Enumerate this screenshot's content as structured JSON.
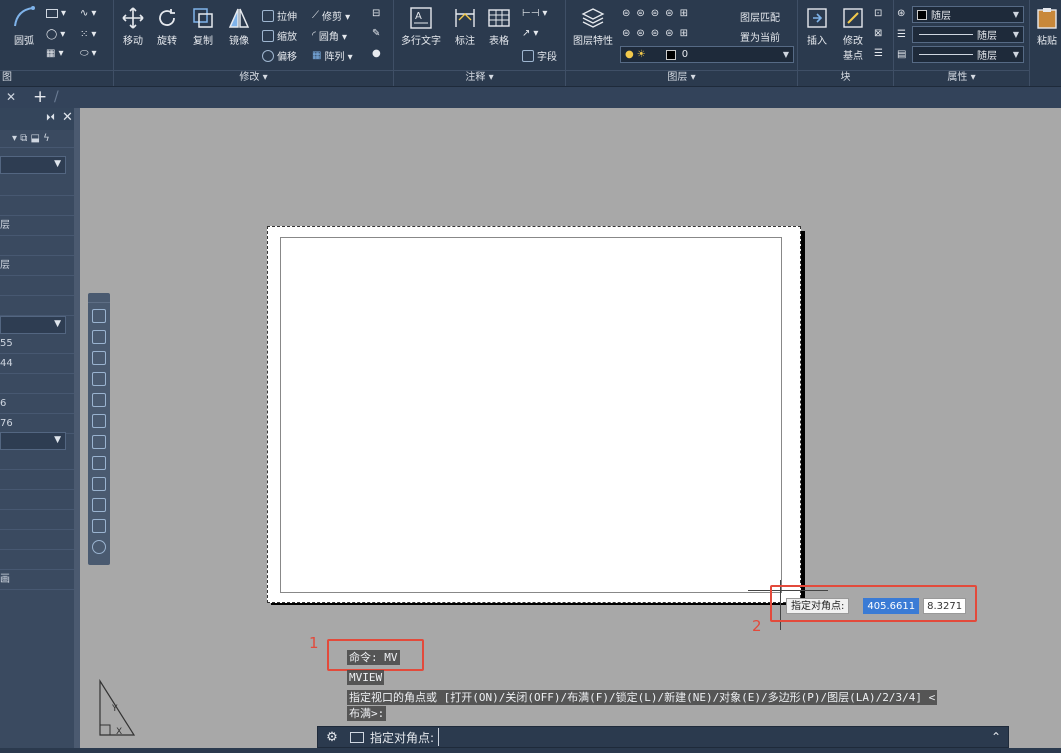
{
  "ribbon": {
    "panels": {
      "draw": {
        "arc_label": "圆弧",
        "title": "图"
      },
      "modify": {
        "title": "修改 ▾",
        "move": "移动",
        "rotate": "旋转",
        "copy": "复制",
        "mirror": "镜像",
        "stretch": "拉伸",
        "scale": "缩放",
        "offset": "偏移",
        "trim": "修剪 ▾",
        "fillet": "圆角 ▾",
        "array": "阵列 ▾"
      },
      "annotation": {
        "title": "注释 ▾",
        "mtext": "多行文字",
        "dimension": "标注",
        "table": "表格",
        "field": "字段"
      },
      "layers": {
        "title": "图层 ▾",
        "properties": "图层特性",
        "match": "图层匹配",
        "make_current": "置为当前",
        "current_layer": "0"
      },
      "block": {
        "title": "块",
        "insert": "插入",
        "edit_base_1": "修改",
        "edit_base_2": "基点"
      },
      "properties": {
        "title": "属性 ▾",
        "color": "随层",
        "linetype": "随层",
        "lineweight": "随层"
      },
      "clipboard": {
        "paste": "粘贴"
      }
    }
  },
  "palette": {
    "rows": [
      "",
      "",
      "",
      "",
      "层",
      "",
      "层",
      "",
      "",
      "",
      "55",
      "44",
      "",
      "6",
      "76",
      "",
      "",
      "",
      "",
      "",
      "",
      "",
      "画"
    ]
  },
  "dynamic_input": {
    "label": "指定对角点:",
    "x_value": "405.6611",
    "y_value": "8.3271"
  },
  "annotations": {
    "num1": "1",
    "num2": "2"
  },
  "history": {
    "line1": "命令: MV",
    "line2": "MVIEW",
    "line3": "指定视口的角点或 [打开(ON)/关闭(OFF)/布满(F)/锁定(L)/新建(NE)/对象(E)/多边形(P)/图层(LA)/2/3/4] <",
    "line4": "布满>:"
  },
  "commandline": {
    "prompt": "指定对角点:",
    "value": ""
  }
}
